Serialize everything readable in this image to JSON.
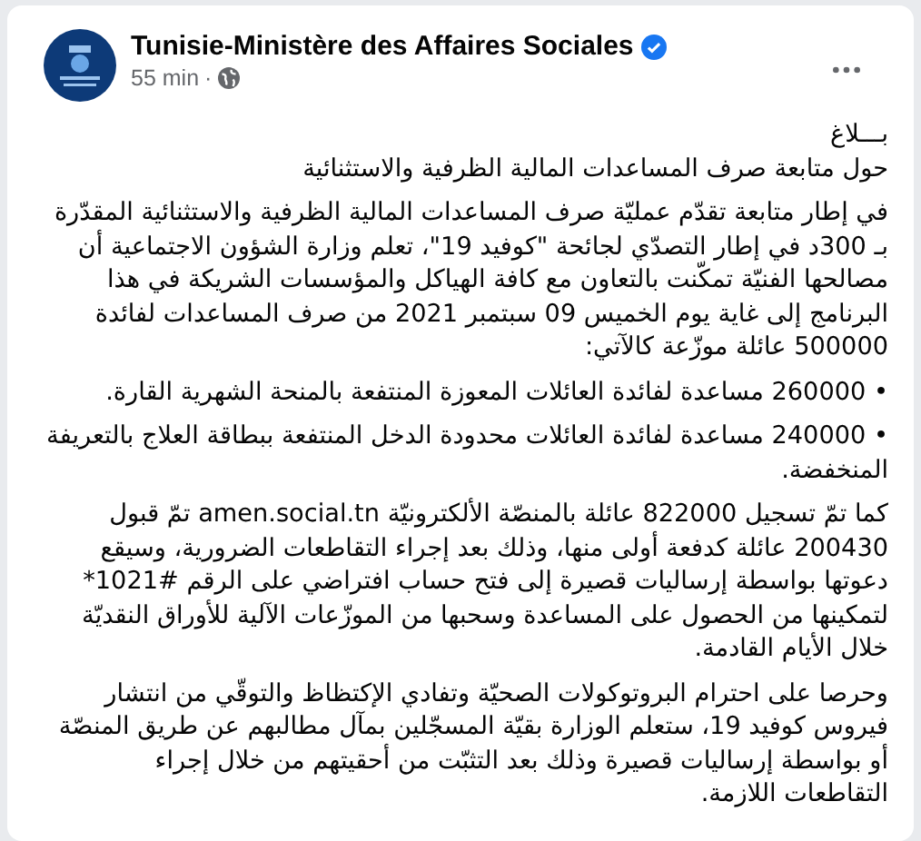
{
  "post": {
    "author": "Tunisie-Ministère des Affaires Sociales",
    "verified": true,
    "time": "55 min",
    "separator": "·",
    "body": [
      {
        "kind": "heading",
        "text": "بـــلاغ"
      },
      {
        "kind": "heading",
        "text": "حول متابعة صرف المساعدات المالية الظرفية والاستثنائية"
      },
      {
        "kind": "paragraph",
        "text": "في إطار متابعة تقدّم عمليّة صرف المساعدات المالية الظرفية والاستثنائية المقدّرة بـ 300د في إطار التصدّي لجائحة \"كوفيد 19\"، تعلم وزارة الشؤون الاجتماعية أن مصالحها الفنيّة تمكّنت بالتعاون مع كافة الهياكل والمؤسسات الشريكة في هذا البرنامج إلى غاية يوم الخميس 09 سبتمبر 2021 من صرف المساعدات لفائدة 500000 عائلة موزّعة كالآتي:"
      },
      {
        "kind": "paragraph",
        "text": "• 260000 مساعدة لفائدة العائلات المعوزة المنتفعة بالمنحة الشهرية القارة."
      },
      {
        "kind": "paragraph",
        "text": "• 240000 مساعدة لفائدة العائلات محدودة الدخل المنتفعة ببطاقة العلاج بالتعريفة المنخفضة."
      },
      {
        "kind": "paragraph",
        "text": "كما تمّ تسجيل 822000 عائلة بالمنصّة الألكترونيّة amen.social.tn تمّ قبول 200430 عائلة كدفعة أولى منها، وذلك بعد إجراء التقاطعات الضرورية، وسيقع دعوتها بواسطة إرساليات قصيرة إلى فتح حساب افتراضي على الرقم #1021* لتمكينها من الحصول على المساعدة وسحبها من الموزّعات الآلية للأوراق النقديّة خلال الأيام القادمة."
      },
      {
        "kind": "paragraph",
        "text": "وحرصا على احترام البروتوكولات الصحيّة وتفادي الإكتظاظ والتوقّي من انتشار فيروس كوفيد 19، ستعلم الوزارة بقيّة المسجّلين بمآل مطالبهم عن طريق المنصّة أو بواسطة إرساليات قصيرة وذلك بعد التثبّت من أحقيتهم من خلال إجراء التقاطعات اللازمة."
      }
    ]
  }
}
